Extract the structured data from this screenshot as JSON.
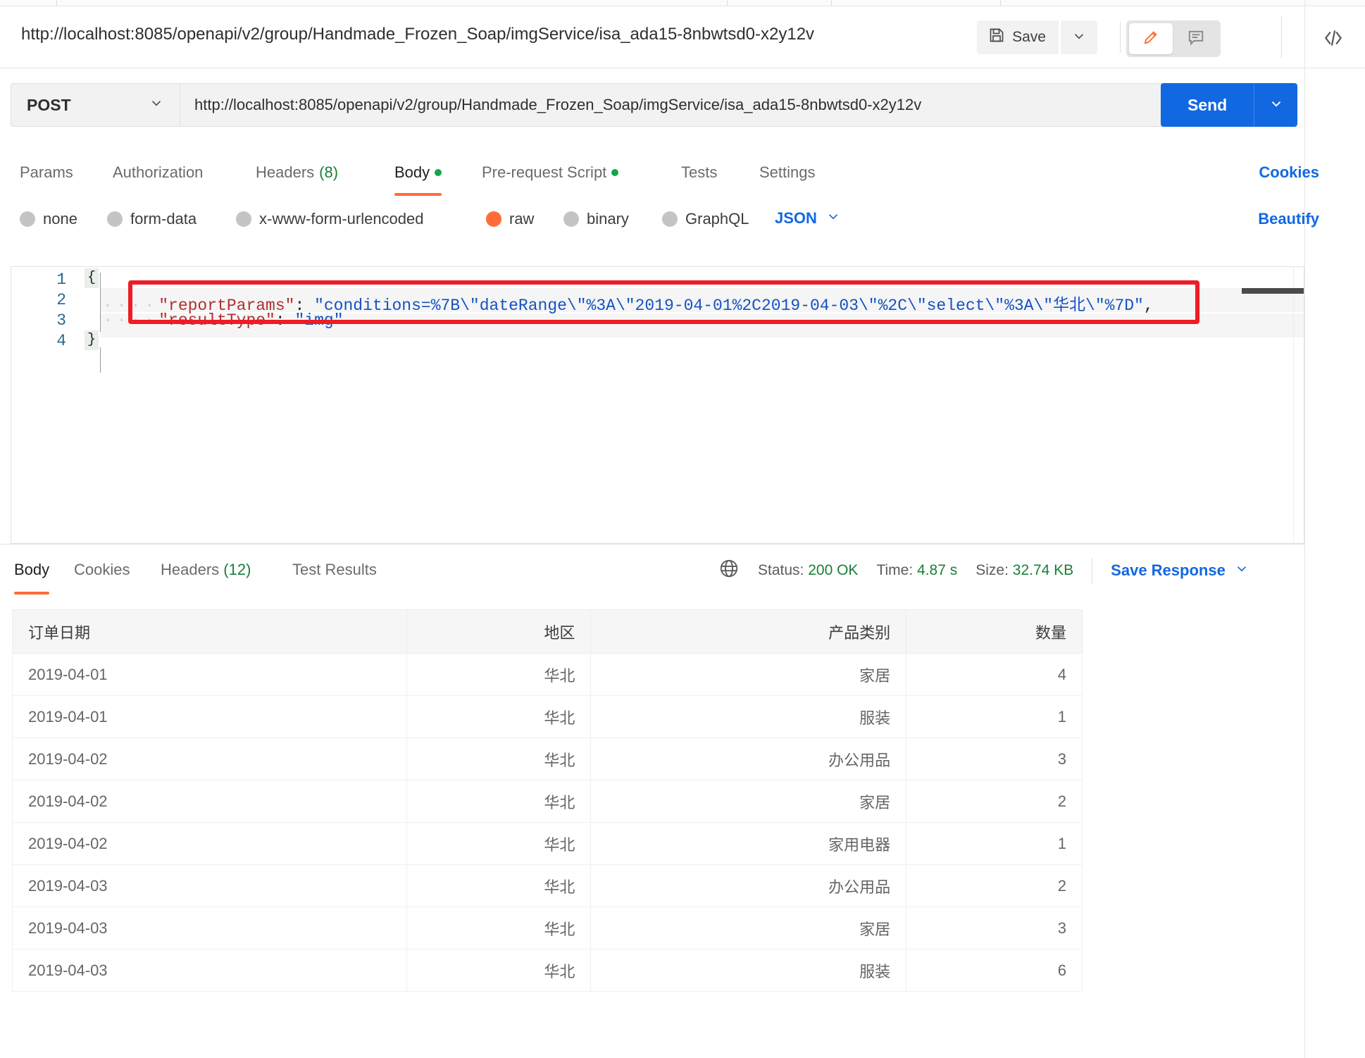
{
  "header": {
    "request_title": "http://localhost:8085/openapi/v2/group/Handmade_Frozen_Soap/imgService/isa_ada15-8nbwtsd0-x2y12v",
    "save_label": "Save",
    "save_icon": "floppy-disk-icon",
    "save_caret_icon": "chevron-down-icon",
    "edit_icon": "pencil-icon",
    "comment_icon": "comment-icon",
    "code_icon": "code-brackets-icon"
  },
  "urlbar": {
    "method": "POST",
    "method_caret_icon": "chevron-down-icon",
    "url": "http://localhost:8085/openapi/v2/group/Handmade_Frozen_Soap/imgService/isa_ada15-8nbwtsd0-x2y12v",
    "send_label": "Send",
    "send_caret_icon": "chevron-down-icon"
  },
  "request_tabs": {
    "items": [
      {
        "label": "Params",
        "count": "",
        "dot": false,
        "active": false
      },
      {
        "label": "Authorization",
        "count": "",
        "dot": false,
        "active": false
      },
      {
        "label": "Headers",
        "count": "(8)",
        "dot": false,
        "active": false
      },
      {
        "label": "Body",
        "count": "",
        "dot": true,
        "active": true
      },
      {
        "label": "Pre-request Script",
        "count": "",
        "dot": true,
        "active": false
      },
      {
        "label": "Tests",
        "count": "",
        "dot": false,
        "active": false
      },
      {
        "label": "Settings",
        "count": "",
        "dot": false,
        "active": false
      }
    ],
    "cookies_label": "Cookies"
  },
  "body_types": {
    "options": [
      {
        "label": "none",
        "selected": false
      },
      {
        "label": "form-data",
        "selected": false
      },
      {
        "label": "x-www-form-urlencoded",
        "selected": false
      },
      {
        "label": "raw",
        "selected": true
      },
      {
        "label": "binary",
        "selected": false
      },
      {
        "label": "GraphQL",
        "selected": false
      }
    ],
    "format_label": "JSON",
    "format_caret_icon": "chevron-down-icon",
    "beautify_label": "Beautify"
  },
  "editor": {
    "line_numbers": [
      "1",
      "2",
      "3",
      "4"
    ],
    "lines": [
      {
        "num": "1",
        "open_brace": "{"
      },
      {
        "num": "2",
        "key": "\"reportParams\"",
        "colon": ":",
        "value": "\"conditions=%7B\\\"dateRange\\\"%3A\\\"2019-04-01%2C2019-04-03\\\"%2C\\\"select\\\"%3A\\\"华北\\\"%7D\"",
        "trail": ","
      },
      {
        "num": "3",
        "key": "\"resultType\"",
        "colon": ":",
        "value": "\"img\"",
        "trail": ""
      },
      {
        "num": "4",
        "close_brace": "}"
      }
    ]
  },
  "response_tabs": {
    "items": [
      {
        "label": "Body",
        "count": "",
        "active": true
      },
      {
        "label": "Cookies",
        "count": "",
        "active": false
      },
      {
        "label": "Headers",
        "count": "(12)",
        "active": false
      },
      {
        "label": "Test Results",
        "count": "",
        "active": false
      }
    ]
  },
  "response_status": {
    "globe_icon": "globe-icon",
    "status_label": "Status:",
    "status_value": "200 OK",
    "time_label": "Time:",
    "time_value": "4.87 s",
    "size_label": "Size:",
    "size_value": "32.74 KB",
    "save_response_label": "Save Response",
    "save_response_caret_icon": "chevron-down-icon"
  },
  "result_table": {
    "columns": [
      "订单日期",
      "地区",
      "产品类别",
      "数量"
    ],
    "rows": [
      [
        "2019-04-01",
        "华北",
        "家居",
        "4"
      ],
      [
        "2019-04-01",
        "华北",
        "服装",
        "1"
      ],
      [
        "2019-04-02",
        "华北",
        "办公用品",
        "3"
      ],
      [
        "2019-04-02",
        "华北",
        "家居",
        "2"
      ],
      [
        "2019-04-02",
        "华北",
        "家用电器",
        "1"
      ],
      [
        "2019-04-03",
        "华北",
        "办公用品",
        "2"
      ],
      [
        "2019-04-03",
        "华北",
        "家居",
        "3"
      ],
      [
        "2019-04-03",
        "华北",
        "服装",
        "6"
      ]
    ]
  },
  "colors": {
    "accent_orange": "#ff6c37",
    "link_blue": "#1268e1",
    "status_green": "#1a7f37",
    "annotation_red": "#ee1c25"
  }
}
